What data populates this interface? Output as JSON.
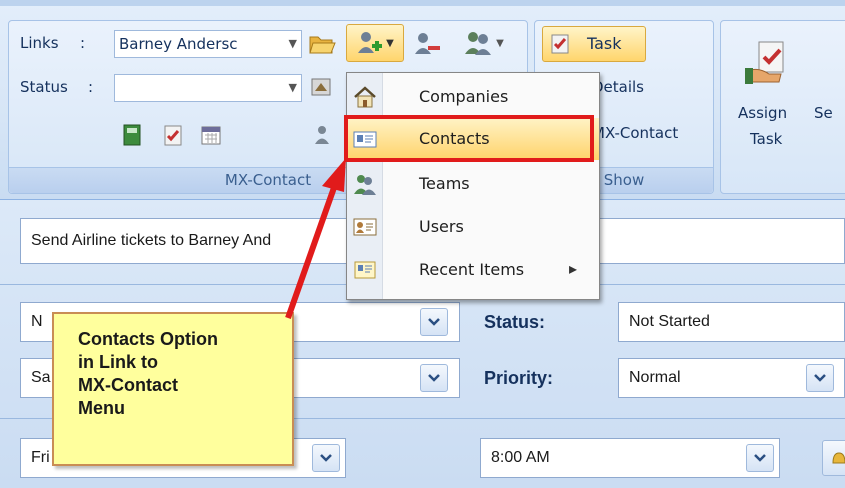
{
  "ribbon": {
    "links_label": "Links",
    "status_label": "Status",
    "links_value": "Barney Andersc",
    "status_value": "",
    "group_mxcontact_label": "MX-Contact",
    "group_show_label": "Show",
    "task_button_label": "Task",
    "details_label": "Details",
    "mxcontact_button_label": "MX-Contact",
    "assign_task_label_1": "Assign",
    "assign_task_label_2": "Task",
    "send_label_partial": "Se"
  },
  "menu": {
    "items": [
      {
        "label": "Companies",
        "icon": "home-icon"
      },
      {
        "label": "Contacts",
        "icon": "contact-card-icon"
      },
      {
        "label": "Teams",
        "icon": "team-icon"
      },
      {
        "label": "Users",
        "icon": "user-card-icon"
      },
      {
        "label": "Recent Items",
        "icon": "recent-card-icon",
        "submenu_arrow": "▸"
      }
    ]
  },
  "form": {
    "subject_value": "Send Airline tickets to Barney And",
    "row1_left_value": "N",
    "row2_left_value": "Sa",
    "date_value": "Fri 4/12/2011",
    "status_label": "Status:",
    "status_value": "Not Started",
    "priority_label": "Priority:",
    "priority_value": "Normal",
    "time_value": "8:00 AM"
  },
  "annotation": {
    "lines": [
      "Contacts Option",
      "in Link to",
      "MX-Contact",
      "Menu"
    ]
  },
  "colors": {
    "highlight_border": "#e11b1b",
    "callout_fill": "#ffff9d",
    "menu_hover": "#ffd36a"
  }
}
